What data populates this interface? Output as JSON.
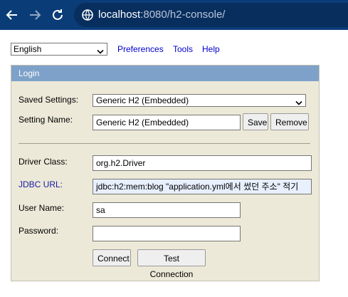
{
  "browser": {
    "url_host": "localhost",
    "url_rest": ":8080/h2-console/"
  },
  "toolbar": {
    "language": "English",
    "preferences": "Preferences",
    "tools": "Tools",
    "help": "Help"
  },
  "login": {
    "title": "Login",
    "saved_settings_label": "Saved Settings:",
    "saved_settings_value": "Generic H2 (Embedded)",
    "setting_name_label": "Setting Name:",
    "setting_name_value": "Generic H2 (Embedded)",
    "save_label": "Save",
    "remove_label": "Remove",
    "driver_class_label": "Driver Class:",
    "driver_class_value": "org.h2.Driver",
    "jdbc_url_label": "JDBC URL:",
    "jdbc_url_value": "jdbc:h2:mem:blog   \"application.yml에서 썼던 주소\" 적기",
    "user_name_label": "User Name:",
    "user_name_value": "sa",
    "password_label": "Password:",
    "password_value": "",
    "connect_label": "Connect",
    "test_connection_label": "Test Connection"
  }
}
